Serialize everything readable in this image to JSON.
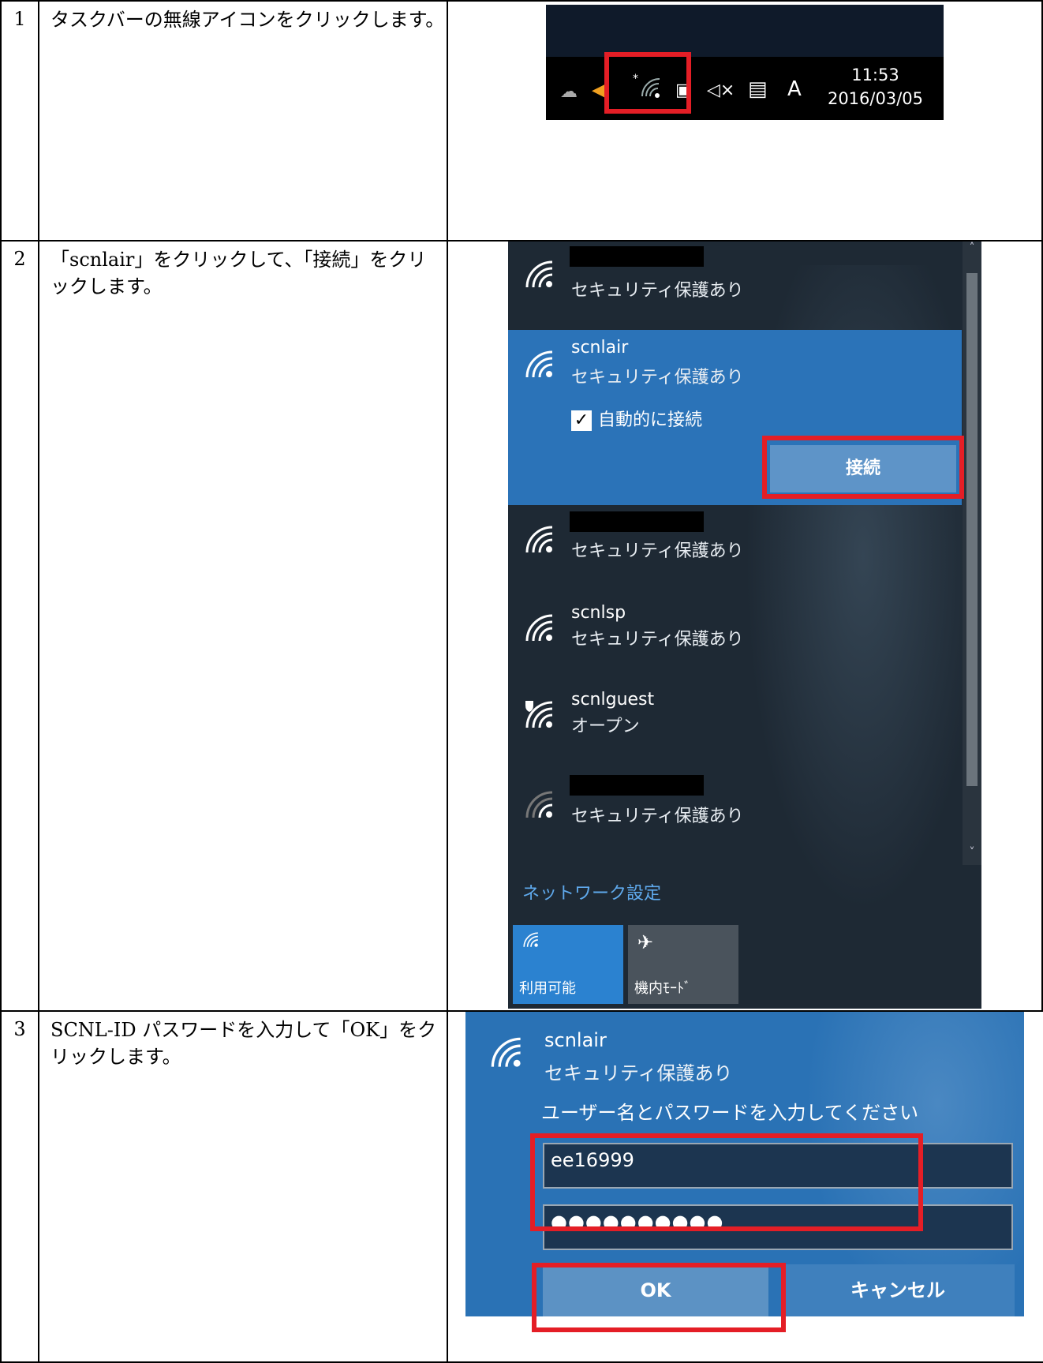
{
  "rows": [
    {
      "num": "1",
      "desc": "タスクバーの無線アイコンをクリックします。"
    },
    {
      "num": "2",
      "desc": "「scnlair」をクリックして、「接続」をクリックします。"
    },
    {
      "num": "3",
      "desc": "SCNL-ID パスワードを入力して「OK」をクリックします。"
    }
  ],
  "taskbar": {
    "time": "11:53",
    "date": "2016/03/05",
    "ime": "A"
  },
  "flyout": {
    "networks": [
      {
        "ssid": "",
        "security": "セキュリティ保護あり",
        "redacted": true
      },
      {
        "ssid": "scnlair",
        "security": "セキュリティ保護あり",
        "selected": true
      },
      {
        "ssid": "",
        "security": "セキュリティ保護あり",
        "redacted": true
      },
      {
        "ssid": "scnlsp",
        "security": "セキュリティ保護あり"
      },
      {
        "ssid": "scnlguest",
        "security": "オープン",
        "shield": true
      },
      {
        "ssid": "",
        "security": "セキュリティ保護あり",
        "redacted": true,
        "weak": true
      }
    ],
    "auto_connect": "自動的に接続",
    "connect": "接続",
    "network_settings": "ネットワーク設定",
    "tile_wifi": "利用可能",
    "tile_airplane": "機内ﾓｰﾄﾞ"
  },
  "dialog": {
    "ssid": "scnlair",
    "security": "セキュリティ保護あり",
    "prompt": "ユーザー名とパスワードを入力してください",
    "username": "ee16999",
    "password": "●●●●●●●●●●",
    "ok": "OK",
    "cancel": "キャンセル"
  },
  "colors": {
    "highlight": "#e41e26",
    "accent": "#2b73b8",
    "link": "#5fa9ec"
  }
}
